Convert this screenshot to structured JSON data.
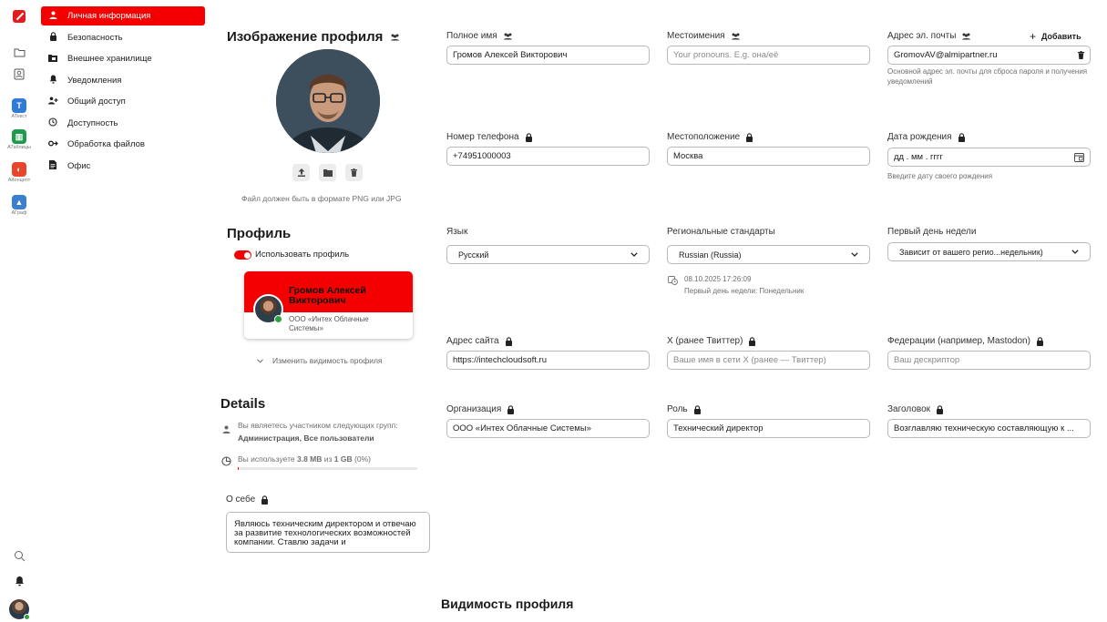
{
  "rail": {
    "apps": [
      {
        "label": "АТекст",
        "color": "#2e7bd8",
        "glyph": "T"
      },
      {
        "label": "АТаблицы",
        "color": "#1e9b4d",
        "glyph": "▥"
      },
      {
        "label": "АКонцепт",
        "color": "#e8452a",
        "glyph": "◐"
      },
      {
        "label": "АГраф",
        "color": "#3a7fd0",
        "glyph": "▲"
      }
    ]
  },
  "nav": {
    "items": [
      {
        "label": "Личная информация",
        "icon": "user-icon"
      },
      {
        "label": "Безопасность",
        "icon": "lock-icon"
      },
      {
        "label": "Внешнее хранилище",
        "icon": "external-storage-icon"
      },
      {
        "label": "Уведомления",
        "icon": "bell-icon"
      },
      {
        "label": "Общий доступ",
        "icon": "share-icon"
      },
      {
        "label": "Доступность",
        "icon": "clock-icon"
      },
      {
        "label": "Обработка файлов",
        "icon": "file-flow-icon"
      },
      {
        "label": "Офис",
        "icon": "document-icon"
      }
    ]
  },
  "profile_picture": {
    "title": "Изображение профиля",
    "hint": "Файл должен быть в формате PNG или JPG"
  },
  "profile": {
    "title": "Профиль",
    "toggle_label": "Использовать профиль",
    "card_name": "Громов Алексей Викторович",
    "card_org": "ООО «Интех Облачные Системы»",
    "visibility_link": "Изменить видимость профиля"
  },
  "details": {
    "title": "Details",
    "groups_text": "Вы являетесь участником следующих групп:",
    "groups_value": "Администрация, Все пользователи",
    "usage_prefix": "Вы используете",
    "usage_used": "3.8 MB",
    "usage_mid": "из",
    "usage_total": "1 GB",
    "usage_pct": "(0%)",
    "usage_fraction": 0.004
  },
  "about": {
    "label": "О себе",
    "value": "Являюсь техническим директором и отвечаю за развитие технологических возможностей компании. Ставлю задачи и"
  },
  "fields": {
    "fullname": {
      "label": "Полное имя",
      "value": "Громов Алексей Викторович"
    },
    "pronouns": {
      "label": "Местоимения",
      "placeholder": "Your pronouns. E.g. она/её"
    },
    "email": {
      "label": "Адрес эл. почты",
      "add": "Добавить",
      "value": "GromovAV@almipartner.ru",
      "hint": "Основной адрес эл. почты для сброса пароля и получения уведомлений"
    },
    "phone": {
      "label": "Номер телефона",
      "value": "+74951000003"
    },
    "location": {
      "label": "Местоположение",
      "value": "Москва"
    },
    "birthday": {
      "label": "Дата рождения",
      "placeholder": "дд . мм . гггг",
      "hint": "Введите дату своего рождения"
    },
    "language": {
      "label": "Язык",
      "value": "Русский"
    },
    "locale": {
      "label": "Региональные стандарты",
      "value": "Russian (Russia)",
      "time": "08.10.2025 17:26:09",
      "first_day_info": "Первый день недели: Понедельник"
    },
    "first_day": {
      "label": "Первый день недели",
      "value": "Зависит от вашего регио...недельник)"
    },
    "website": {
      "label": "Адрес сайта",
      "value": "https://intechcloudsoft.ru"
    },
    "twitter": {
      "label": "X (ранее Твиттер)",
      "placeholder": "Ваше имя в сети X (ранее — Твиттер)"
    },
    "fediverse": {
      "label": "Федерации (например, Mastodon)",
      "placeholder": "Ваш дескриптор"
    },
    "organisation": {
      "label": "Организация",
      "value": "ООО «Интех Облачные Системы»"
    },
    "role": {
      "label": "Роль",
      "value": "Технический директор"
    },
    "headline": {
      "label": "Заголовок",
      "value": "Возглавляю техническую составляющую к ..."
    }
  },
  "visibility_section": {
    "title": "Видимость профиля"
  },
  "colors": {
    "accent": "#f40000",
    "text": "#222222"
  }
}
